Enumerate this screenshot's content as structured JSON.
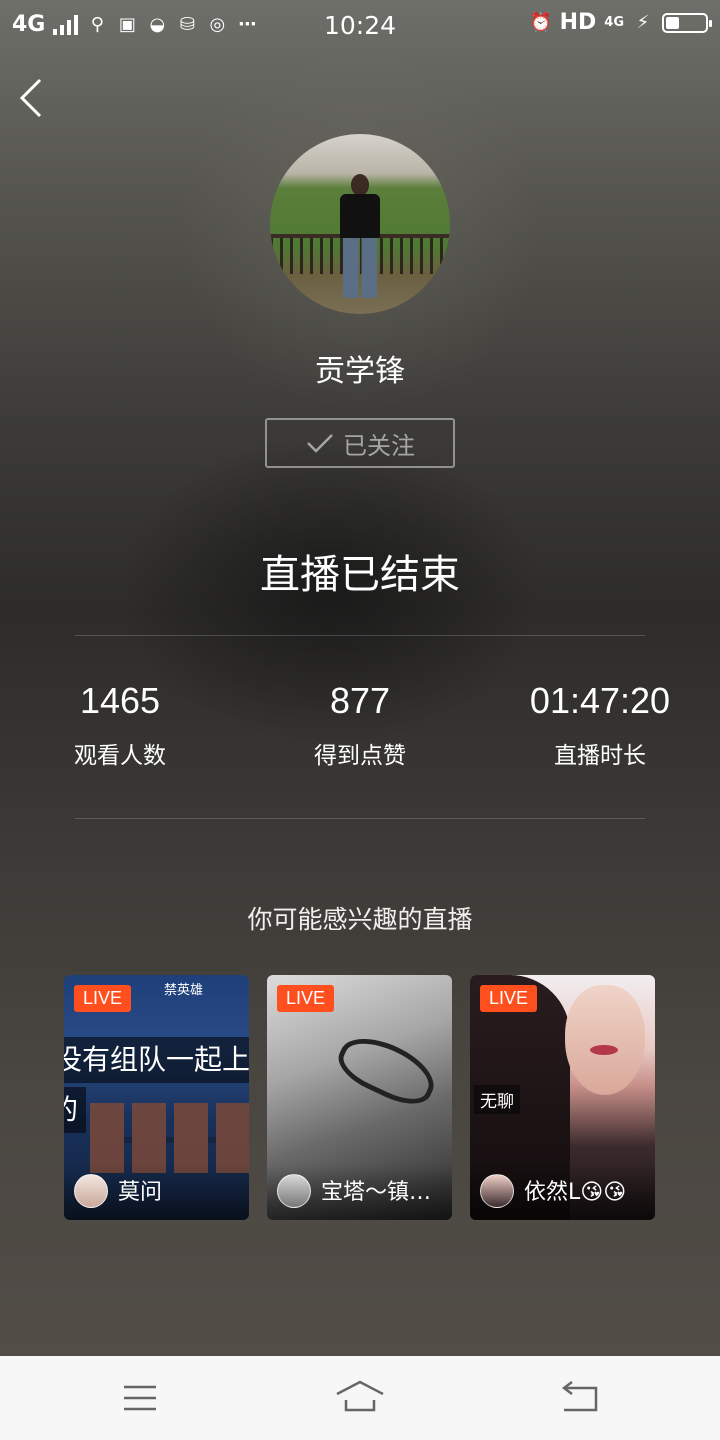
{
  "status_bar": {
    "network_label": "4G",
    "time": "10:24",
    "hd_label": "HD",
    "network_label_2": "4G",
    "battery_level": 0.35
  },
  "header": {
    "back_icon": "chevron-left-icon"
  },
  "profile": {
    "name": "贡学锋",
    "follow_label": "已关注",
    "follow_icon": "checkmark-icon"
  },
  "summary": {
    "title": "直播已结束",
    "stats": [
      {
        "value": "1465",
        "label": "观看人数"
      },
      {
        "value": "877",
        "label": "得到点赞"
      },
      {
        "value": "01:47:20",
        "label": "直播时长"
      }
    ]
  },
  "recommend": {
    "title": "你可能感兴趣的直播",
    "cards": [
      {
        "badge": "LIVE",
        "name": "莫问",
        "overlay_text": "没有组队一起上",
        "overlay_text_2": "的",
        "top_label": "禁英雄"
      },
      {
        "badge": "LIVE",
        "name": "宝塔～镇…"
      },
      {
        "badge": "LIVE",
        "name": "依然L😘😘",
        "tag": "无聊"
      }
    ]
  },
  "navbar": {
    "icons": [
      "menu-icon",
      "home-icon",
      "back-icon"
    ]
  },
  "colors": {
    "live_badge": "#ff4f1f",
    "navbar_bg": "#f7f7f7"
  }
}
